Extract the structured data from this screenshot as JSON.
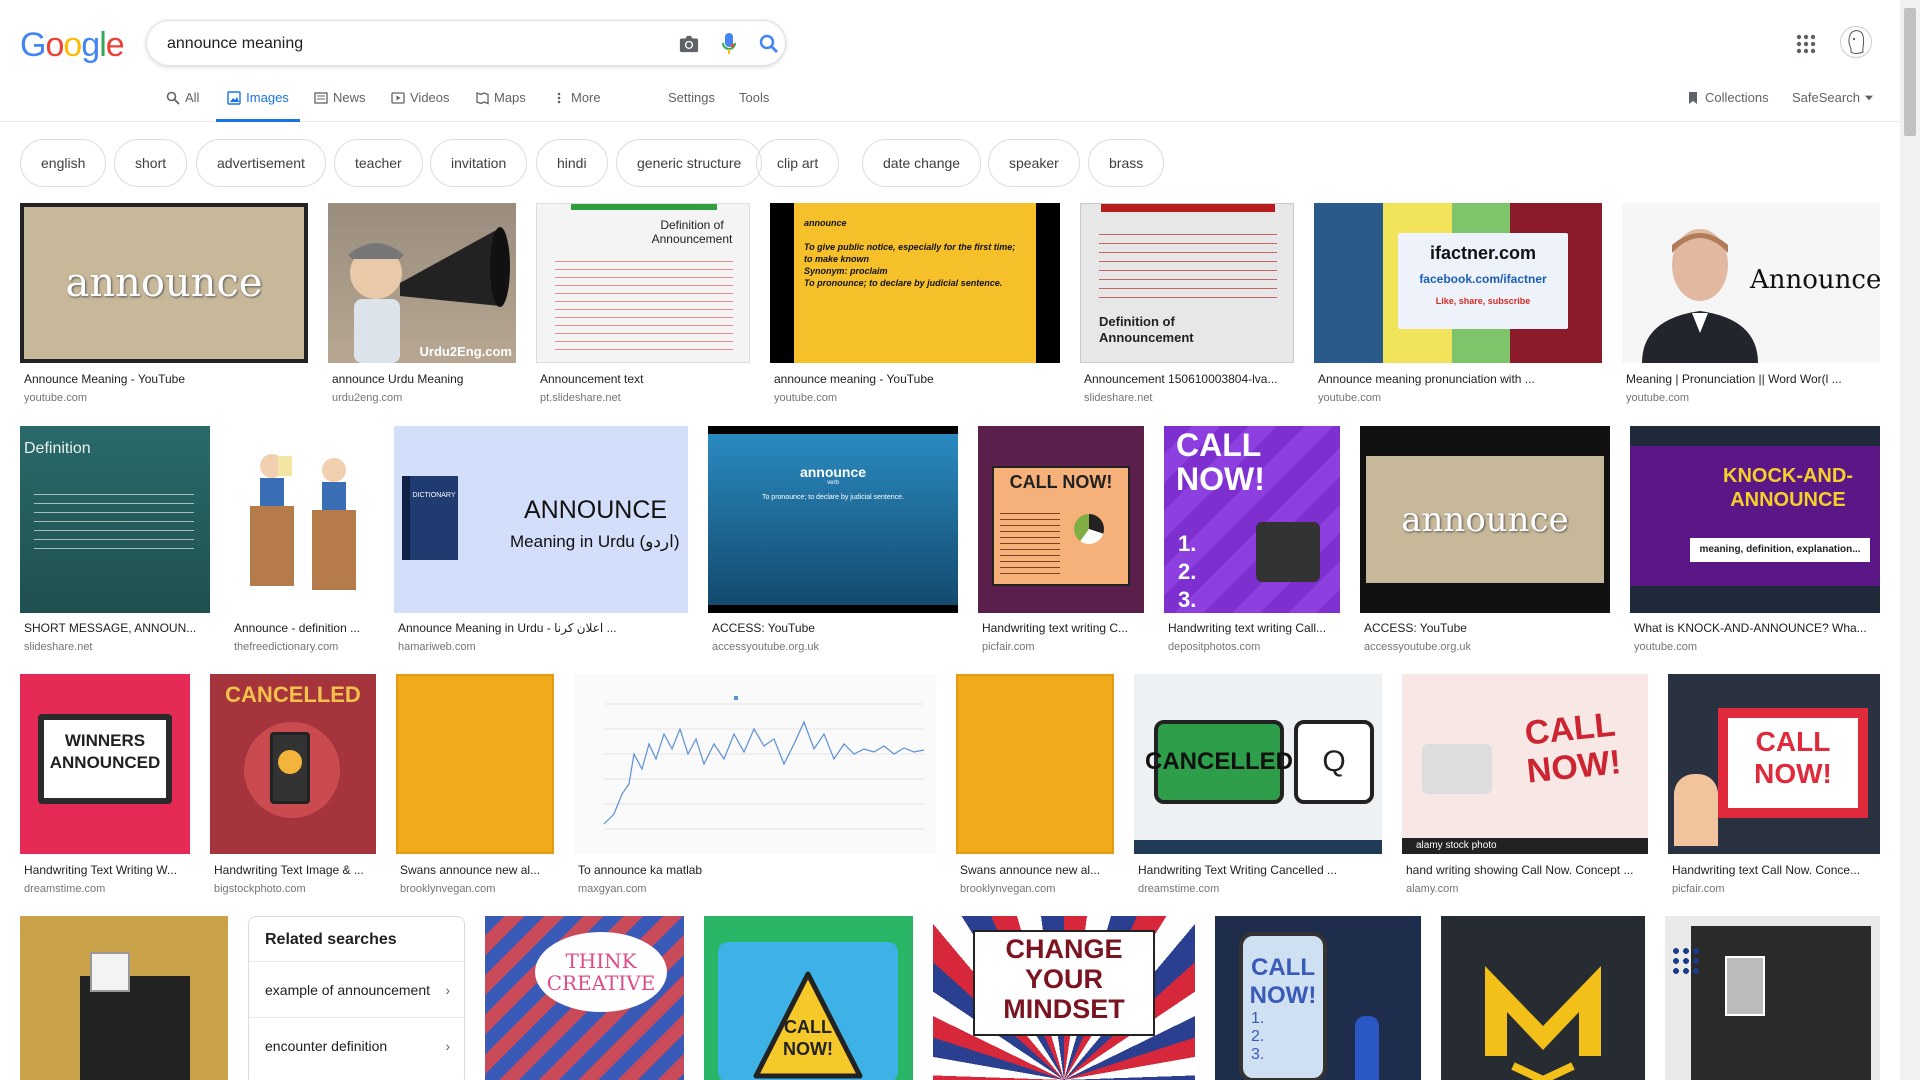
{
  "logo": {
    "letters": [
      "G",
      "o",
      "o",
      "g",
      "l",
      "e"
    ]
  },
  "search": {
    "query": "announce meaning",
    "placeholder": ""
  },
  "nav": {
    "all": "All",
    "images": "Images",
    "news": "News",
    "videos": "Videos",
    "maps": "Maps",
    "more": "More",
    "settings": "Settings",
    "tools": "Tools",
    "collections": "Collections",
    "safesearch": "SafeSearch"
  },
  "chips": [
    "english",
    "short",
    "advertisement",
    "teacher",
    "invitation",
    "hindi",
    "generic structure",
    "clip art",
    "date change",
    "speaker",
    "brass"
  ],
  "row1": [
    {
      "caption": "Announce Meaning - YouTube",
      "source": "youtube.com",
      "text": "announce"
    },
    {
      "caption": "announce Urdu Meaning",
      "source": "urdu2eng.com",
      "text": "Urdu2Eng.com"
    },
    {
      "caption": "Announcement text",
      "source": "pt.slideshare.net",
      "text": "Definition of Announcement"
    },
    {
      "caption": "announce meaning - YouTube",
      "source": "youtube.com",
      "text": "announce"
    },
    {
      "caption": "Announcement 150610003804-lva...",
      "source": "slideshare.net",
      "text": "Definition of Announcement"
    },
    {
      "caption": "Announce meaning pronunciation with ...",
      "source": "youtube.com",
      "text": "ifactner.com"
    },
    {
      "caption": "Meaning | Pronunciation || Word Wor(l ...",
      "source": "youtube.com",
      "text": "Announce"
    }
  ],
  "row1_extra": {
    "yt_line1": "To give public notice, especially for the first time; to make known",
    "yt_line2": "Synonym: proclaim",
    "yt_line3": "To pronounce; to declare by judicial sentence.",
    "fb": "facebook.com/ifactner",
    "fb_sub": "Like, share, subscribe"
  },
  "row2": [
    {
      "caption": "SHORT MESSAGE, ANNOUN...",
      "source": "slideshare.net",
      "text": "Definition"
    },
    {
      "caption": "Announce - definition ...",
      "source": "thefreedictionary.com",
      "text": ""
    },
    {
      "caption": "Announce Meaning in Urdu - اعلان کرنا ...",
      "source": "hamariweb.com",
      "text": "ANNOUNCE",
      "sub": "Meaning in Urdu (اردو)",
      "book": "DICTIONARY"
    },
    {
      "caption": "ACCESS: YouTube",
      "source": "accessyoutube.org.uk",
      "text": "announce",
      "sub": "To pronounce; to declare by judicial sentence.",
      "small": "verb"
    },
    {
      "caption": "Handwriting text writing C...",
      "source": "picfair.com",
      "text": "CALL NOW!"
    },
    {
      "caption": "Handwriting text writing Call...",
      "source": "depositphotos.com",
      "text": "CALL NOW!",
      "sub": "1. 2. 3."
    },
    {
      "caption": "ACCESS: YouTube",
      "source": "accessyoutube.org.uk",
      "text": "announce"
    },
    {
      "caption": "What is KNOCK-AND-ANNOUNCE? Wha...",
      "source": "youtube.com",
      "text": "KNOCK-AND-ANNOUNCE",
      "sub": "meaning, definition, explanation..."
    }
  ],
  "row3": [
    {
      "caption": "Handwriting Text Writing W...",
      "source": "dreamstime.com",
      "text": "WINNERS ANNOUNCED"
    },
    {
      "caption": "Handwriting Text Image & ...",
      "source": "bigstockphoto.com",
      "text": "CANCELLED"
    },
    {
      "caption": "Swans announce new al...",
      "source": "brooklynvegan.com",
      "text": ""
    },
    {
      "caption": "To announce ka matlab",
      "source": "maxgyan.com",
      "text": ""
    },
    {
      "caption": "Swans announce new al...",
      "source": "brooklynvegan.com",
      "text": ""
    },
    {
      "caption": "Handwriting Text Writing Cancelled ...",
      "source": "dreamstime.com",
      "text": "CANCELLED",
      "sub": "Q"
    },
    {
      "caption": "hand writing showing Call Now. Concept ...",
      "source": "alamy.com",
      "text": "CALL NOW!",
      "sub": "alamy stock photo"
    },
    {
      "caption": "Handwriting text Call Now. Conce...",
      "source": "picfair.com",
      "text": "CALL NOW!"
    }
  ],
  "row4": {
    "think": "THINK CREATIVE",
    "callnow": "CALL NOW!",
    "change": "CHANGE YOUR MINDSET",
    "phone": "CALL NOW!",
    "phone_list": "1. 2. 3."
  },
  "related": {
    "title": "Related searches",
    "items": [
      "example of announcement",
      "encounter definition"
    ]
  },
  "colors": {
    "blue": "#1a73e8",
    "logo": [
      "#4285f4",
      "#ea4335",
      "#fbbc05",
      "#4285f4",
      "#34a853",
      "#ea4335"
    ]
  }
}
